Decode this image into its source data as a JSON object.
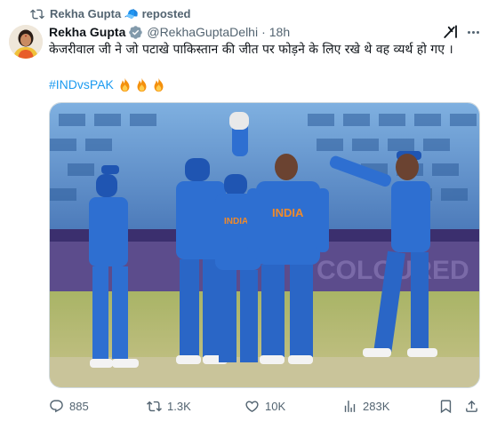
{
  "repost": {
    "text": "Rekha Gupta 🧢 reposted"
  },
  "tweet": {
    "display_name": "Rekha Gupta",
    "handle": "@RekhaGuptaDelhi",
    "separator": "·",
    "time": "18h",
    "text": "केजरीवाल जी ने जो पटाखे पाकिस्तान की जीत पर फोड़ने के लिए रखे थे वह व्यर्थ हो गए ।",
    "hashtag": "#INDvsPAK",
    "emoji_count": 3
  },
  "photo": {
    "jersey_text": "INDIA",
    "banner_text": "COLOURED"
  },
  "actions": {
    "replies": "885",
    "reposts": "1.3K",
    "likes": "10K",
    "views": "283K"
  },
  "icons": {
    "repost": "repost-icon",
    "verified": "verified-badge-icon",
    "grok": "grok-icon",
    "more": "more-icon",
    "reply": "reply-icon",
    "like": "heart-icon",
    "views": "analytics-icon",
    "bookmark": "bookmark-icon",
    "share": "share-icon",
    "fire": "fire-icon"
  },
  "colors": {
    "link": "#1d9bf0",
    "muted": "#536471",
    "text": "#0f1419",
    "jersey": "#2e6fd1"
  }
}
